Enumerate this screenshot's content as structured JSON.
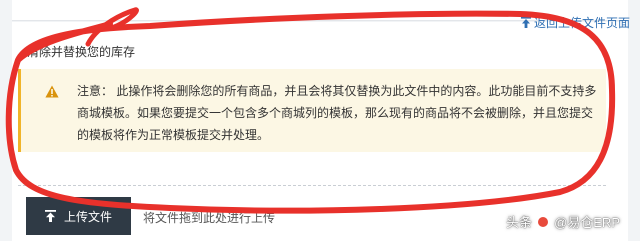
{
  "header": {
    "back_link_label": "返回上传文件页面"
  },
  "section": {
    "title": "清除并替换您的库存"
  },
  "alert": {
    "message": "注意： 此操作将会删除您的所有商品，并且会将其仅替换为此文件中的内容。此功能目前不支持多商城模板。如果您要提交一个包含多个商城列的模板，那么现有的商品将不会被删除，并且您提交的模板将作为正常模板提交并处理。"
  },
  "upload": {
    "button_label": "上传文件",
    "drop_hint": "将文件拖到此处进行上传"
  },
  "watermark": {
    "source": "头条",
    "author": "@易仓ERP"
  },
  "colors": {
    "link": "#2f6fb3",
    "warning_border": "#f0b429",
    "warning_bg": "#fcf7e4",
    "button_bg": "#2f3a45",
    "annotation_red": "#e8312b"
  },
  "icons": {
    "back": "upload-arrow-icon",
    "alert": "warning-triangle-icon",
    "upload": "upload-arrow-icon"
  }
}
